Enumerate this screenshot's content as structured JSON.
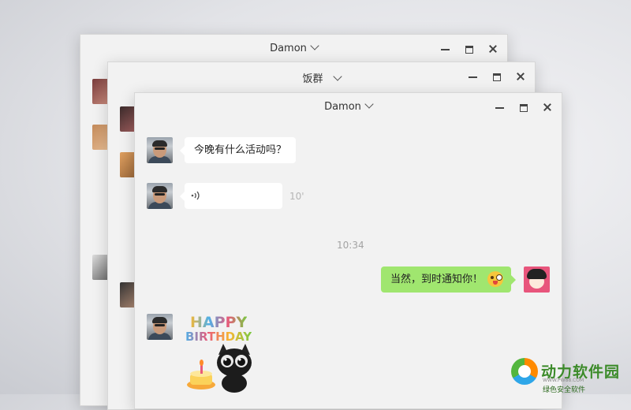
{
  "windows": {
    "back": {
      "title": "Damon"
    },
    "middle": {
      "title": "饭群"
    },
    "front": {
      "title": "Damon"
    }
  },
  "messages": {
    "m1": {
      "text": "今晚有什么活动吗？"
    },
    "m2": {
      "duration": "10'"
    },
    "timestamp": "10:34",
    "m3": {
      "text": "当然，到时通知你！"
    },
    "sticker": {
      "line1": "HAPPY",
      "line2": "BIRTHDAY"
    }
  },
  "watermark": {
    "name": "动力软件园",
    "url": "WWW.PW88.COM",
    "sub": "绿色安全软件"
  },
  "colors": {
    "my_bubble": "#a0e66f",
    "their_bubble": "#ffffff",
    "window_bg": "#f2f2f2"
  },
  "icons": [
    "minimize-icon",
    "maximize-icon",
    "close-icon",
    "chevron-down-icon",
    "voice-icon",
    "emoji-icon"
  ]
}
